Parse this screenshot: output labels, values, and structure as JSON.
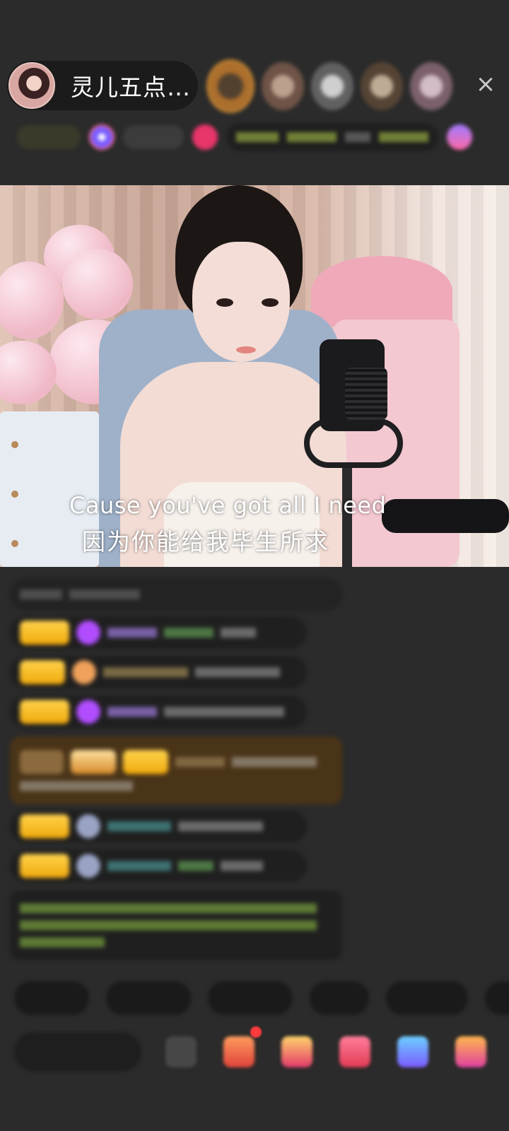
{
  "header": {
    "host_name": "灵儿五点…",
    "close_icon": "×",
    "viewer_avatars": [
      "viewer-avatar-1",
      "viewer-avatar-2",
      "viewer-avatar-3",
      "viewer-avatar-4",
      "viewer-avatar-5"
    ]
  },
  "video": {
    "subtitle_en": "Cause you've got all I need",
    "subtitle_zh": "因为你能给我毕生所求"
  },
  "colors": {
    "background": "#2b2b2b",
    "badge_gold": "#f0a90b",
    "chat_green": "#bfe04a"
  }
}
